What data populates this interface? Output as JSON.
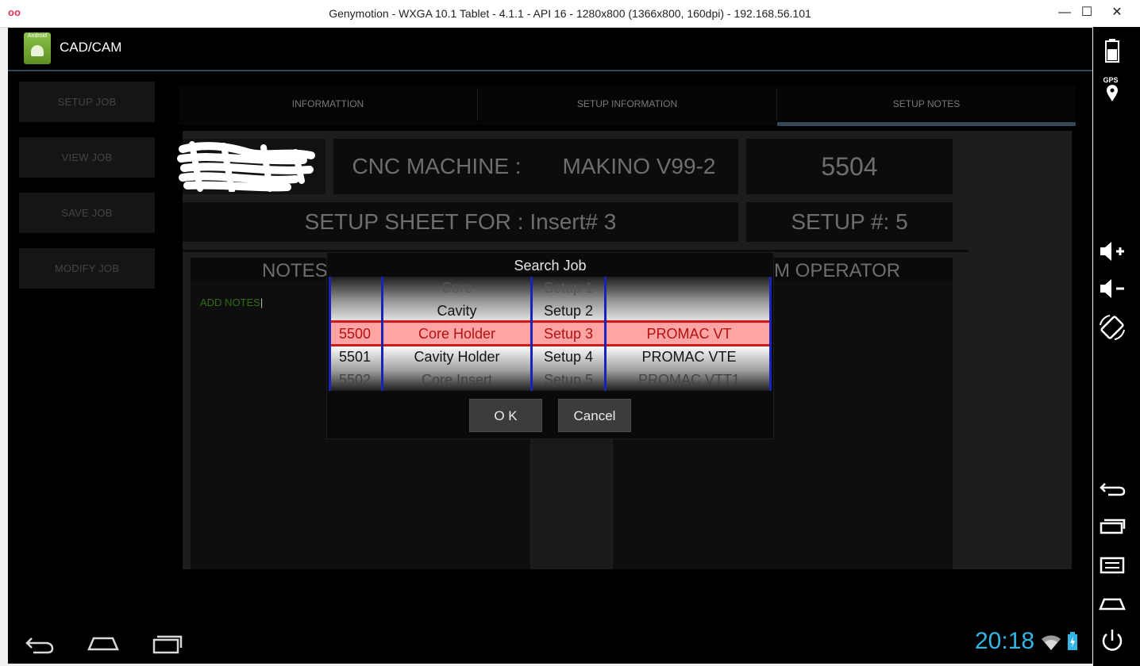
{
  "window": {
    "title": "Genymotion - WXGA 10.1 Tablet - 4.1.1 - API 16 - 1280x800 (1366x800, 160dpi) - 192.168.56.101",
    "logo_glyph": "oo",
    "minimize": "—",
    "maximize": "☐",
    "close": "✕"
  },
  "app": {
    "title": "CAD/CAM",
    "icon_label": "Android"
  },
  "menu": [
    {
      "label": "SETUP JOB"
    },
    {
      "label": "VIEW JOB"
    },
    {
      "label": "SAVE JOB"
    },
    {
      "label": "MODIFY JOB"
    }
  ],
  "tabs": [
    {
      "label": "INFORMATTION"
    },
    {
      "label": "SETUP INFORMATION"
    },
    {
      "label": "SETUP NOTES",
      "selected": true
    }
  ],
  "header": {
    "machine_label": "CNC MACHINE :",
    "machine_value": "MAKINO V99-2",
    "job_number": "5504",
    "sheet_title": "SETUP SHEET FOR : Insert# 3",
    "setup_no": "SETUP #:  5"
  },
  "notes": {
    "label": "NOTES",
    "placeholder": "ADD NOTES"
  },
  "operator": {
    "label": "M OPERATOR"
  },
  "dialog": {
    "title": "Search Job",
    "columns": {
      "job": [
        "",
        "",
        "5500",
        "5501",
        "5502"
      ],
      "part": [
        "Core",
        "Cavity",
        "Core Holder",
        "Cavity Holder",
        "Core Insert"
      ],
      "setup": [
        "Setup 1",
        "Setup 2",
        "Setup 3",
        "Setup 4",
        "Setup 5"
      ],
      "machine": [
        "",
        "",
        "PROMAC VT",
        "PROMAC VTE",
        "PROMAC VTT1"
      ]
    },
    "ok_label": "O K",
    "cancel_label": "Cancel"
  },
  "statusbar": {
    "clock": "20:18"
  },
  "sidebar": {
    "gps_label": "GPS"
  },
  "colors": {
    "accent": "#33b5e5",
    "selection": "#ffa4a4",
    "selection_border": "#d01818",
    "picker_divider": "#1a23b8"
  }
}
